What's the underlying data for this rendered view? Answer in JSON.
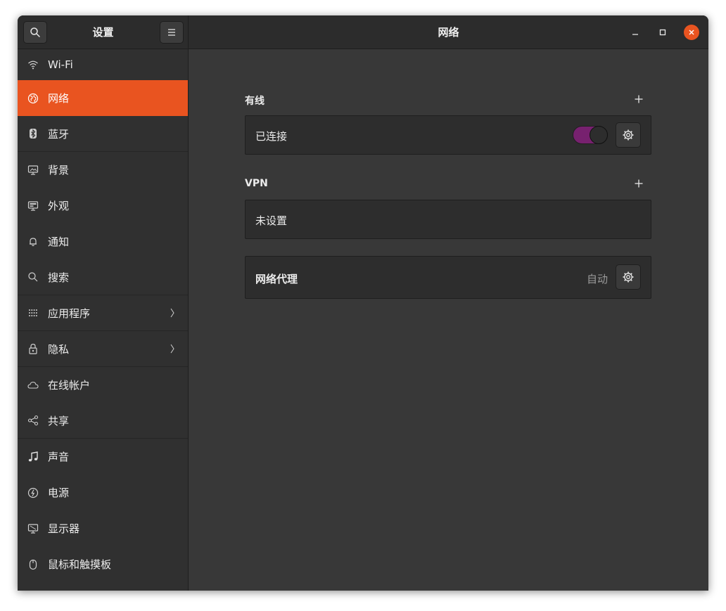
{
  "header": {
    "sidebar_title": "设置",
    "main_title": "网络"
  },
  "sidebar": {
    "items": [
      {
        "label": "Wi-Fi",
        "icon": "wifi-icon"
      },
      {
        "label": "网络",
        "icon": "network-icon",
        "active": true
      },
      {
        "label": "蓝牙",
        "icon": "bluetooth-icon"
      },
      {
        "label": "背景",
        "icon": "background-icon"
      },
      {
        "label": "外观",
        "icon": "appearance-icon"
      },
      {
        "label": "通知",
        "icon": "bell-icon"
      },
      {
        "label": "搜索",
        "icon": "search-icon"
      },
      {
        "label": "应用程序",
        "icon": "apps-grid-icon",
        "chevron": true
      },
      {
        "label": "隐私",
        "icon": "lock-icon",
        "chevron": true
      },
      {
        "label": "在线帐户",
        "icon": "cloud-icon"
      },
      {
        "label": "共享",
        "icon": "share-icon"
      },
      {
        "label": "声音",
        "icon": "music-note-icon"
      },
      {
        "label": "电源",
        "icon": "power-icon"
      },
      {
        "label": "显示器",
        "icon": "display-icon"
      },
      {
        "label": "鼠标和触摸板",
        "icon": "mouse-icon"
      }
    ]
  },
  "wired": {
    "title": "有线",
    "status": "已连接",
    "enabled": true
  },
  "vpn": {
    "title": "VPN",
    "status": "未设置"
  },
  "proxy": {
    "label": "网络代理",
    "status": "自动"
  },
  "colors": {
    "accent": "#e95420",
    "switch_on": "#77216f",
    "bg": "#383838",
    "sidebar": "#303030",
    "row": "#2d2d2d"
  }
}
